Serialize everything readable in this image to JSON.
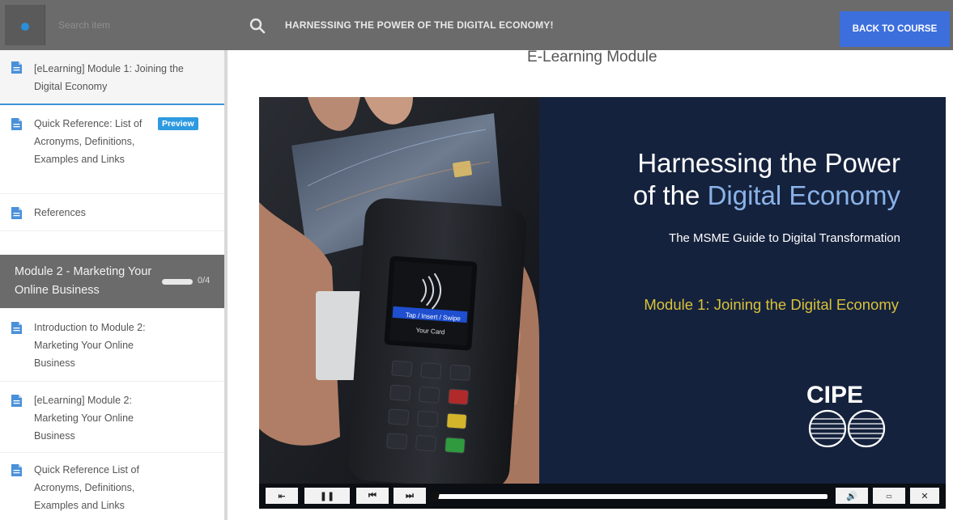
{
  "topbar": {
    "search_placeholder": "Search item",
    "course_title": "HARNESSING THE POWER OF THE DIGITAL ECONOMY!",
    "back_label": "BACK TO COURSE"
  },
  "sidebar": {
    "items": [
      {
        "label": "[eLearning] Module 1: Joining the Digital Economy",
        "icon": "document-icon",
        "active": true
      },
      {
        "label": "Quick Reference: List of Acronyms, Definitions, Examples and Links",
        "icon": "document-icon",
        "badge": "Preview"
      },
      {
        "label": "References",
        "icon": "document-icon"
      }
    ],
    "module2": {
      "title": "Module 2 - Marketing Your Online Business",
      "progress_text": "0/4",
      "progress_fraction": 0
    },
    "module2_items": [
      {
        "label": "Introduction to Module 2: Marketing Your Online Business",
        "icon": "document-icon"
      },
      {
        "label": "[eLearning] Module 2: Marketing Your Online Business",
        "icon": "document-icon"
      },
      {
        "label": "Quick Reference List of Acronyms, Definitions, Examples and Links",
        "icon": "document-icon"
      }
    ]
  },
  "main": {
    "page_title": "E-Learning Module",
    "slide": {
      "headline_line1": "Harnessing the Power",
      "headline_of_the": "of the ",
      "headline_accent": "Digital Economy",
      "subtitle": "The MSME Guide to Digital Transformation",
      "module_line": "Module 1: Joining the Digital Economy",
      "logo_text": "CIPE",
      "terminal_prompt_1": "Tap / Insert / Swipe",
      "terminal_prompt_2": "Your Card"
    },
    "player": {
      "playback_fraction": 0.0
    }
  },
  "colors": {
    "topbar": "#6b6b6b",
    "accent_blue": "#3d6fdc",
    "slide_bg": "#15223d",
    "slide_accent": "#8ab3e8",
    "module_gold": "#d8c23a"
  }
}
